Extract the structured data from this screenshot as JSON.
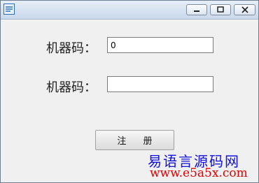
{
  "window": {
    "controls": {
      "minimize_icon": "minimize-icon",
      "maximize_icon": "maximize-icon",
      "close_icon": "close-icon"
    }
  },
  "form": {
    "row1": {
      "label": "机器码：",
      "value": "0"
    },
    "row2": {
      "label": "机器码：",
      "value": ""
    },
    "register_label": "注  册"
  },
  "watermark": {
    "line1": "易语言源码网",
    "line2": "www.e5a5x.com"
  },
  "colors": {
    "watermark_blue": "#1010d8",
    "watermark_red": "#e00000"
  }
}
